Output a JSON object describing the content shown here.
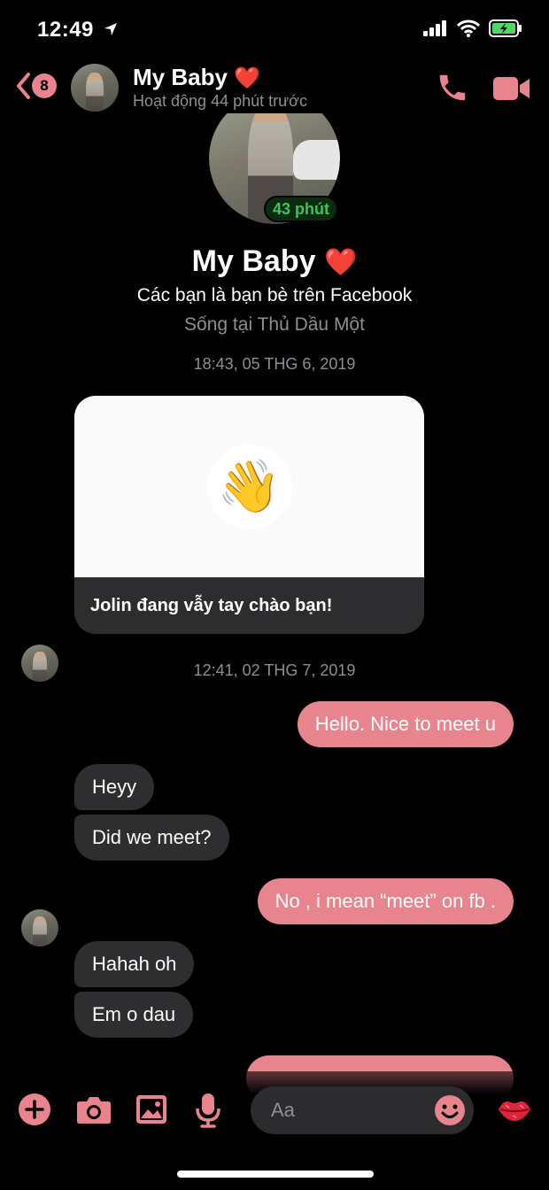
{
  "status_bar": {
    "time": "12:49",
    "icons": [
      "location-arrow-icon",
      "signal-icon",
      "wifi-icon",
      "battery-charging-icon"
    ]
  },
  "header": {
    "back_badge": "8",
    "name": "My Baby",
    "heart": "❤️",
    "subtitle": "Hoạt động 44 phút trước",
    "icons": [
      "phone-icon",
      "video-camera-icon"
    ]
  },
  "profile": {
    "active_badge": "43 phút",
    "name": "My Baby",
    "heart": "❤️",
    "friends_text": "Các bạn là bạn bè trên Facebook",
    "location_text": "Sống tại Thủ Dầu Một"
  },
  "conversation": {
    "timestamp_1": "18:43, 05 THG 6, 2019",
    "wave_emoji": "👋",
    "wave_text": "Jolin đang vẫy tay chào bạn!",
    "timestamp_2": "12:41, 02 THG 7, 2019",
    "messages": [
      {
        "sender": "me",
        "text": "Hello. Nice to meet u"
      },
      {
        "sender": "them",
        "text": "Heyy"
      },
      {
        "sender": "them",
        "text": "Did we meet?"
      },
      {
        "sender": "me",
        "text": "No , i mean “meet” on fb ."
      },
      {
        "sender": "them",
        "text": "Hahah oh"
      },
      {
        "sender": "them",
        "text": "Em o dau"
      },
      {
        "sender": "me",
        "text": ""
      }
    ]
  },
  "composer": {
    "placeholder": "Aa",
    "icons": [
      "plus-icon",
      "camera-icon",
      "gallery-icon",
      "microphone-icon",
      "emoji-icon",
      "kiss-lips-icon"
    ]
  },
  "colors": {
    "accent": "#e8848d",
    "incoming_bubble": "#2e2e30",
    "background": "#000000",
    "active_green": "#41c25a"
  }
}
